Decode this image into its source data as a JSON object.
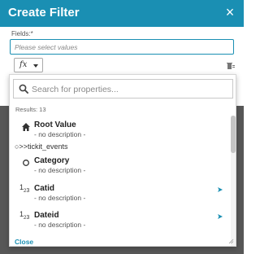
{
  "dialog": {
    "title": "Create Filter",
    "fields_label": "Fields:*",
    "fields_placeholder": "Please select values"
  },
  "toolbar": {
    "fx_label": "fx"
  },
  "popup": {
    "search_placeholder": "Search for properties...",
    "results_text": "Results: 13",
    "close_label": "Close",
    "group_label": "tickit_events",
    "items": [
      {
        "name": "Root Value",
        "desc": "- no description -",
        "icon": "home-icon"
      },
      {
        "name": "Category",
        "desc": "- no description -",
        "icon": "circle-icon"
      },
      {
        "name": "Catid",
        "desc": "- no description -",
        "icon": "numeric-type-icon"
      },
      {
        "name": "Dateid",
        "desc": "- no description -",
        "icon": "numeric-type-icon"
      }
    ]
  },
  "colors": {
    "accent": "#1a8fb3",
    "overlay": "#575757"
  }
}
